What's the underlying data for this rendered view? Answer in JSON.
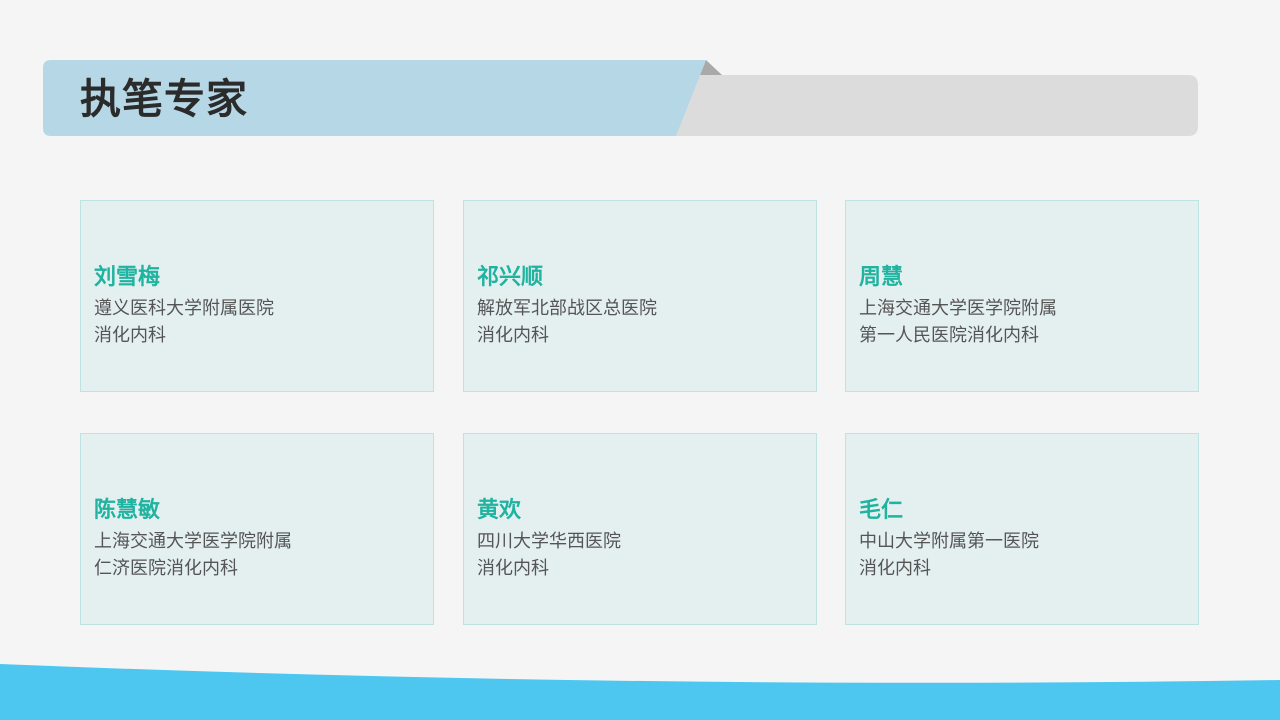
{
  "title": "执笔专家",
  "colors": {
    "title_band": "#b6d7e6",
    "title_gray": "#dcdcdc",
    "name_teal": "#1fb3a0",
    "card_bg": "#e4f0f0",
    "wave_blue": "#4dc6f0"
  },
  "experts": [
    {
      "name": "刘雪梅",
      "line1": "遵义医科大学附属医院",
      "line2": "消化内科"
    },
    {
      "name": "祁兴顺",
      "line1": "解放军北部战区总医院",
      "line2": "消化内科"
    },
    {
      "name": "周慧",
      "line1": "上海交通大学医学院附属",
      "line2": "第一人民医院消化内科"
    },
    {
      "name": "陈慧敏",
      "line1": "上海交通大学医学院附属",
      "line2": "仁济医院消化内科"
    },
    {
      "name": "黄欢",
      "line1": "四川大学华西医院",
      "line2": "消化内科"
    },
    {
      "name": "毛仁",
      "line1": "中山大学附属第一医院",
      "line2": "消化内科"
    }
  ]
}
